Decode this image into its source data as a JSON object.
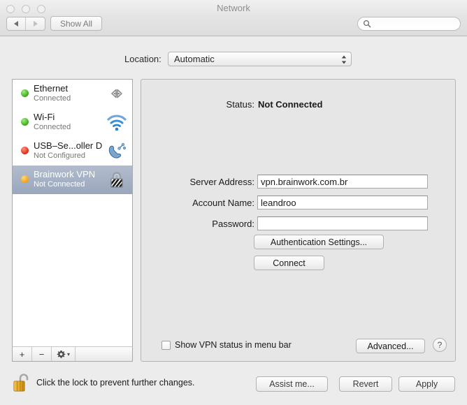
{
  "window": {
    "title": "Network",
    "traffic_lights": [
      "close",
      "minimize",
      "zoom"
    ]
  },
  "toolbar": {
    "back_icon": "triangle-left-icon",
    "forward_icon": "triangle-right-icon",
    "show_all_label": "Show All",
    "search_placeholder": "",
    "search_value": "",
    "search_icon": "search-icon"
  },
  "location": {
    "label": "Location:",
    "value": "Automatic",
    "options": [
      "Automatic"
    ]
  },
  "sidebar": {
    "services": [
      {
        "name": "Ethernet",
        "status": "Connected",
        "dot": "green",
        "icon": "ethernet-icon",
        "selected": false
      },
      {
        "name": "Wi-Fi",
        "status": "Connected",
        "dot": "green",
        "icon": "wifi-icon",
        "selected": false
      },
      {
        "name": "USB–Se...oller D",
        "status": "Not Configured",
        "dot": "red",
        "icon": "modem-phone-icon",
        "selected": false
      },
      {
        "name": "Brainwork VPN",
        "status": "Not Connected",
        "dot": "amber",
        "icon": "padlock-icon",
        "selected": true
      }
    ],
    "toolbar": {
      "add_label": "+",
      "remove_label": "−",
      "gear_icon": "gear-icon",
      "gear_caret": "▾"
    }
  },
  "detail": {
    "status_label": "Status:",
    "status_value": "Not Connected",
    "server_label": "Server Address:",
    "server_value": "vpn.brainwork.com.br",
    "account_label": "Account Name:",
    "account_value": "leandroo",
    "password_label": "Password:",
    "password_value": "",
    "auth_button": "Authentication Settings...",
    "connect_button": "Connect",
    "show_status_checkbox": "Show VPN status in menu bar",
    "show_status_checked": false,
    "advanced_button": "Advanced...",
    "help_button": "?"
  },
  "footer": {
    "lock_icon": "unlocked-padlock-icon",
    "lock_text": "Click the lock to prevent further changes.",
    "assist_button": "Assist me...",
    "revert_button": "Revert",
    "apply_button": "Apply"
  },
  "colors": {
    "selection": "#9aa6bc",
    "status_green": "#3ea81f",
    "status_red": "#de2d15",
    "status_amber": "#f0a318",
    "pane_bg": "#e6e6e6",
    "window_bg": "#ececec"
  }
}
